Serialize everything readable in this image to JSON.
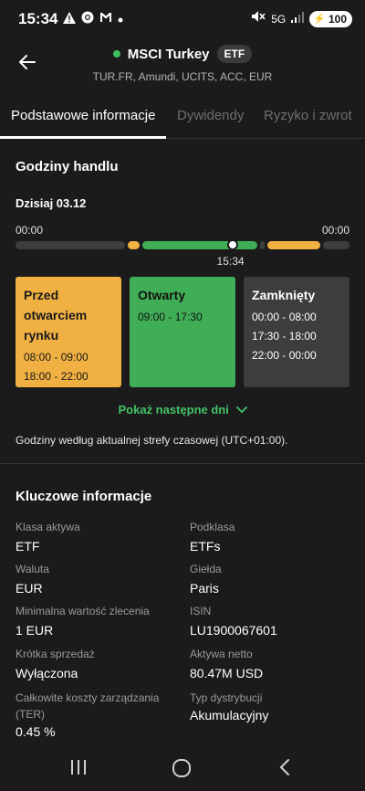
{
  "status_bar": {
    "time": "15:34",
    "left_icons": [
      "warning-icon",
      "chrome-icon",
      "gmail-icon",
      "dot-icon"
    ],
    "network": "5G",
    "battery": "100"
  },
  "header": {
    "title": "MSCI Turkey",
    "badge": "ETF",
    "subtitle": "TUR.FR, Amundi, UCITS, ACC, EUR",
    "status_color": "#3fbf5a"
  },
  "tabs": [
    {
      "label": "Podstawowe informacje",
      "active": true
    },
    {
      "label": "Dywidendy",
      "active": false
    },
    {
      "label": "Ryzyko i zwrot",
      "active": false
    }
  ],
  "trading_hours": {
    "title": "Godziny handlu",
    "today_label": "Dzisiaj 03.12",
    "range_start": "00:00",
    "range_end": "00:00",
    "current_time": "15:34",
    "current_fraction": 0.649,
    "segments": [
      {
        "from": 0.0,
        "to": 0.333,
        "status": "closed"
      },
      {
        "from": 0.333,
        "to": 0.375,
        "status": "pre"
      },
      {
        "from": 0.375,
        "to": 0.729,
        "status": "open"
      },
      {
        "from": 0.729,
        "to": 0.75,
        "status": "closed"
      },
      {
        "from": 0.75,
        "to": 0.917,
        "status": "pre"
      },
      {
        "from": 0.917,
        "to": 1.0,
        "status": "closed"
      }
    ],
    "colors": {
      "pre": "#f0b042",
      "open": "#3fae56",
      "closed": "#3d3d3d"
    },
    "cards": {
      "pre": {
        "title_lines": [
          "Przed",
          "otwarciem",
          "rynku"
        ],
        "hours": [
          "08:00 - 09:00",
          "18:00 - 22:00"
        ]
      },
      "open": {
        "title_lines": [
          "Otwarty"
        ],
        "hours": [
          "09:00 - 17:30"
        ]
      },
      "closed": {
        "title_lines": [
          "Zamknięty"
        ],
        "hours": [
          "00:00 - 08:00",
          "17:30 - 18:00",
          "22:00 - 00:00"
        ]
      }
    },
    "show_more": "Pokaż następne dni",
    "timezone_note": "Godziny według aktualnej strefy czasowej (UTC+01:00)."
  },
  "key_info": {
    "title": "Kluczowe informacje",
    "items": [
      {
        "label": "Klasa aktywa",
        "value": "ETF"
      },
      {
        "label": "Podklasa",
        "value": "ETFs"
      },
      {
        "label": "Waluta",
        "value": "EUR"
      },
      {
        "label": "Giełda",
        "value": "Paris"
      },
      {
        "label": "Minimalna wartość zlecenia",
        "value": "1 EUR"
      },
      {
        "label": "ISIN",
        "value": "LU1900067601"
      },
      {
        "label": "Krótka sprzedaż",
        "value": "Wyłączona"
      },
      {
        "label": "Aktywa netto",
        "value": "80.47M USD"
      },
      {
        "label": "Całkowite koszty zarządzania (TER)",
        "value": "0.45 %"
      },
      {
        "label": "Typ dystrybucji",
        "value": "Akumulacyjny"
      }
    ]
  },
  "navbar": [
    "recents-icon",
    "home-icon",
    "back-icon"
  ]
}
